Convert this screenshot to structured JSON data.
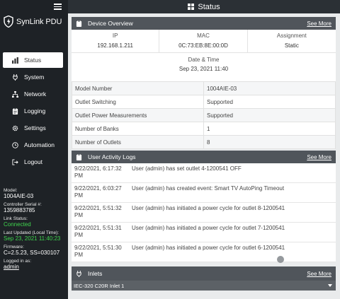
{
  "app": {
    "title": "SynLink PDU",
    "page_title": "Status"
  },
  "nav": {
    "items": [
      {
        "label": "Status",
        "icon": "bar-chart-icon"
      },
      {
        "label": "System",
        "icon": "plug-icon"
      },
      {
        "label": "Network",
        "icon": "network-icon"
      },
      {
        "label": "Logging",
        "icon": "clipboard-icon"
      },
      {
        "label": "Settings",
        "icon": "gear-icon"
      },
      {
        "label": "Automation",
        "icon": "clock-icon"
      },
      {
        "label": "Logout",
        "icon": "logout-icon"
      }
    ]
  },
  "side_info": {
    "model_label": "Model:",
    "model": "1004AIE-03",
    "serial_label": "Controller Serial #:",
    "serial": "1359883785",
    "link_label": "Link Status:",
    "link": "Connected",
    "updated_label": "Last Updated (Local Time):",
    "updated": "Sep 23, 2021 11:40:23",
    "firmware_label": "Firmware:",
    "firmware": "C=2.5.23, SS=030107",
    "logged_label": "Logged in as:",
    "user": "admin"
  },
  "overview": {
    "title": "Device Overview",
    "more": "See More",
    "ip_label": "IP",
    "ip": "192.168.1.211",
    "mac_label": "MAC",
    "mac": "0C:73:EB:8E:00:0D",
    "assign_label": "Assignment",
    "assign": "Static",
    "date_label": "Date & Time",
    "date": "Sep 23, 2021 11:40",
    "rows": [
      {
        "k": "Model Number",
        "v": "1004AIE-03"
      },
      {
        "k": "Outlet Switching",
        "v": "Supported"
      },
      {
        "k": "Outlet Power Measurements",
        "v": "Supported"
      },
      {
        "k": "Number of Banks",
        "v": "1"
      },
      {
        "k": "Number of Outlets",
        "v": "8"
      }
    ]
  },
  "activity": {
    "title": "User Activity Logs",
    "more": "See More",
    "rows": [
      {
        "t": "9/22/2021, 6:17:32 PM",
        "m": "User (admin) has set outlet 4-1200541 OFF"
      },
      {
        "t": "9/22/2021, 6:03:27 PM",
        "m": "User (admin) has created event: Smart TV AutoPing Timeout"
      },
      {
        "t": "9/22/2021, 5:51:32 PM",
        "m": "User (admin) has initiated a power cycle for outlet 8-1200541"
      },
      {
        "t": "9/22/2021, 5:51:31 PM",
        "m": "User (admin) has initiated a power cycle for outlet 7-1200541"
      },
      {
        "t": "9/22/2021, 5:51:30 PM",
        "m": "User (admin) has initiated a power cycle for outlet 6-1200541"
      }
    ]
  },
  "inlets": {
    "title": "Inlets",
    "more": "See More",
    "selected": "IEC-320 C20R Inlet 1"
  },
  "colors": {
    "sidebar": "#1e2226",
    "header": "#50555b",
    "connected": "#3fd54e"
  }
}
